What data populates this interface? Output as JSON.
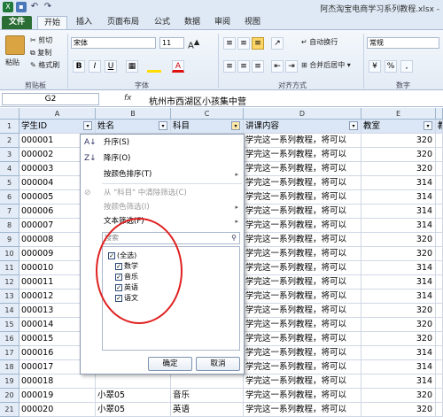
{
  "window": {
    "title": "阿杰淘宝电商学习系列教程.xlsx -",
    "accent_file_tab": "#2a6e35",
    "excel_green": "#1f7a3a"
  },
  "tabs": [
    {
      "label": "文件"
    },
    {
      "label": "开始"
    },
    {
      "label": "插入"
    },
    {
      "label": "页面布局"
    },
    {
      "label": "公式"
    },
    {
      "label": "数据"
    },
    {
      "label": "审阅"
    },
    {
      "label": "视图"
    }
  ],
  "ribbon": {
    "paste": "粘贴",
    "cut": "剪切",
    "copy": "复制",
    "format_painter": "格式刷",
    "clipboard_group": "剪贴板",
    "font_name": "宋体",
    "font_size": "11",
    "bold": "B",
    "italic": "I",
    "underline": "U",
    "font_color_letter": "A",
    "font_group": "字体",
    "wrap_text": "自动换行",
    "merge_center": "合并后居中",
    "alignment_group": "对齐方式",
    "number_format": "常规",
    "number_group": "数字"
  },
  "formula_bar": {
    "name_box": "G2",
    "fx": "fx",
    "content": "杭州市西湖区小孩集中营"
  },
  "columns": [
    "A",
    "B",
    "C",
    "D",
    "E"
  ],
  "header_row": {
    "num": "1",
    "cells": [
      "学生ID",
      "姓名",
      "科目",
      "讲课内容",
      "教室",
      "教"
    ]
  },
  "rows": [
    {
      "num": "2",
      "id": "000001",
      "content": "学完这一系列教程，将可以",
      "room": "320"
    },
    {
      "num": "3",
      "id": "000002",
      "content": "学完这一系列教程，将可以",
      "room": "320"
    },
    {
      "num": "4",
      "id": "000003",
      "content": "学完这一系列教程，将可以",
      "room": "320"
    },
    {
      "num": "5",
      "id": "000004",
      "content": "学完这一系列教程，将可以",
      "room": "314"
    },
    {
      "num": "6",
      "id": "000005",
      "content": "学完这一系列教程，将可以",
      "room": "314"
    },
    {
      "num": "7",
      "id": "000006",
      "content": "学完这一系列教程，将可以",
      "room": "314"
    },
    {
      "num": "8",
      "id": "000007",
      "content": "学完这一系列教程，将可以",
      "room": "314"
    },
    {
      "num": "9",
      "id": "000008",
      "content": "学完这一系列教程，将可以",
      "room": "320"
    },
    {
      "num": "10",
      "id": "000009",
      "content": "学完这一系列教程，将可以",
      "room": "320"
    },
    {
      "num": "11",
      "id": "000010",
      "content": "学完这一系列教程，将可以",
      "room": "314"
    },
    {
      "num": "12",
      "id": "000011",
      "content": "学完这一系列教程，将可以",
      "room": "314"
    },
    {
      "num": "13",
      "id": "000012",
      "content": "学完这一系列教程，将可以",
      "room": "314"
    },
    {
      "num": "14",
      "id": "000013",
      "content": "学完这一系列教程，将可以",
      "room": "320"
    },
    {
      "num": "15",
      "id": "000014",
      "content": "学完这一系列教程，将可以",
      "room": "320"
    },
    {
      "num": "16",
      "id": "000015",
      "content": "学完这一系列教程，将可以",
      "room": "320"
    },
    {
      "num": "17",
      "id": "000016",
      "content": "学完这一系列教程，将可以",
      "room": "314"
    },
    {
      "num": "18",
      "id": "000017",
      "content": "学完这一系列教程，将可以",
      "room": "314"
    },
    {
      "num": "19",
      "id": "000018",
      "content": "学完这一系列教程，将可以",
      "room": "314"
    },
    {
      "num": "20",
      "id": "000019",
      "name": "小翠05",
      "subject": "音乐",
      "content": "学完这一系列教程，将可以",
      "room": "320"
    },
    {
      "num": "21",
      "id": "000020",
      "name": "小翠05",
      "subject": "英语",
      "content": "学完这一系列教程，将可以",
      "room": "320"
    }
  ],
  "filter_menu": {
    "sort_asc": "升序(S)",
    "sort_desc": "降序(O)",
    "sort_by_color": "按颜色排序(T)",
    "clear_filter": "从 \"科目\" 中清除筛选(C)",
    "filter_by_color": "按颜色筛选(I)",
    "text_filters": "文本筛选(F)",
    "search_placeholder": "搜索",
    "items": [
      {
        "label": "(全选)",
        "checked": true
      },
      {
        "label": "数学",
        "checked": true
      },
      {
        "label": "音乐",
        "checked": true
      },
      {
        "label": "英语",
        "checked": true
      },
      {
        "label": "语文",
        "checked": true
      }
    ],
    "ok": "确定",
    "cancel": "取消",
    "highlight_color": "#e02020"
  }
}
